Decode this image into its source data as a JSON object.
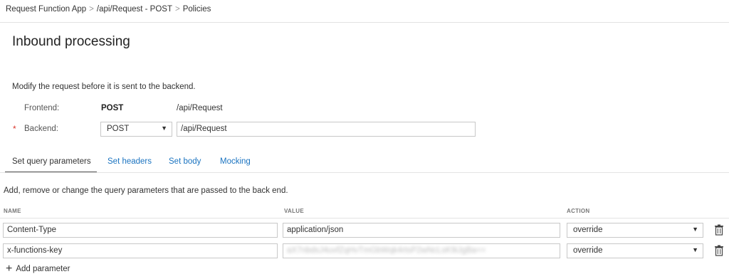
{
  "breadcrumb": {
    "items": [
      "Request Function App",
      "/api/Request - POST",
      "Policies"
    ],
    "separator": ">"
  },
  "page": {
    "title": "Inbound processing"
  },
  "description": "Modify the request before it is sent to the backend.",
  "frontend": {
    "label": "Frontend:",
    "method": "POST",
    "url": "/api/Request"
  },
  "backend": {
    "required_mark": "*",
    "label": "Backend:",
    "method": "POST",
    "url": "/api/Request"
  },
  "tabs": [
    {
      "label": "Set query parameters",
      "active": true
    },
    {
      "label": "Set headers",
      "active": false
    },
    {
      "label": "Set body",
      "active": false
    },
    {
      "label": "Mocking",
      "active": false
    }
  ],
  "query": {
    "description": "Add, remove or change the query parameters that are passed to the back end.",
    "columns": {
      "name": "NAME",
      "value": "VALUE",
      "action": "ACTION"
    },
    "rows": [
      {
        "name": "Content-Type",
        "value": "application/json",
        "action": "override"
      },
      {
        "name": "x-functions-key",
        "value": "aX7nbdsJ4uvfZqHvTmGbWqk4rtsP2wNcLsK9iJgBa==",
        "action": "override",
        "value_obscured": true
      }
    ],
    "add_label": "Add parameter"
  },
  "colors": {
    "link": "#1a73c0",
    "required": "#d9362b",
    "border": "#c8c8c8"
  }
}
